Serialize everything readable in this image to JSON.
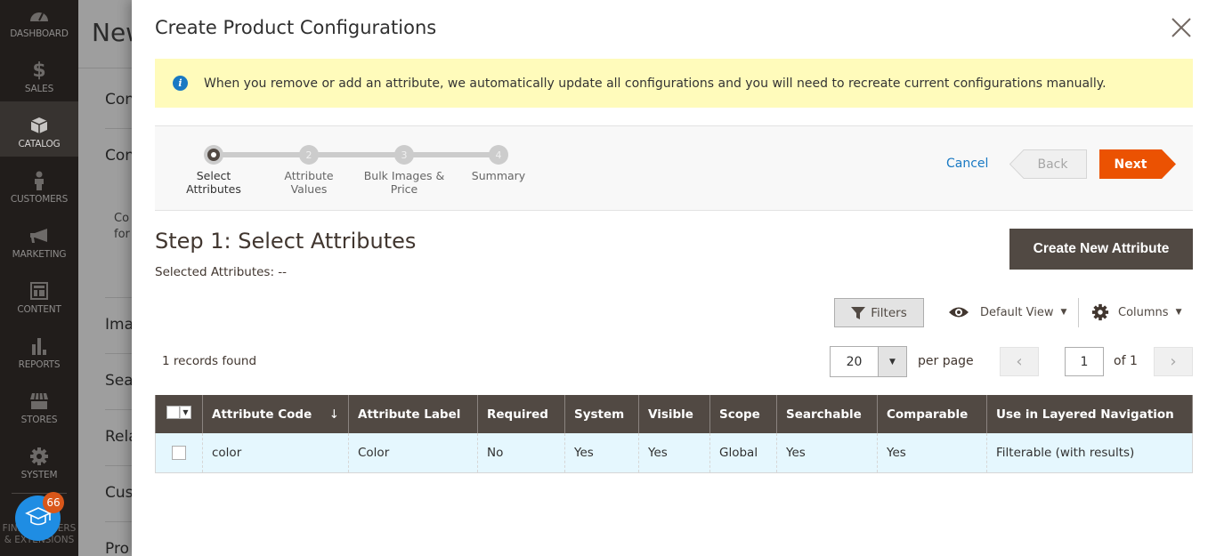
{
  "sidebar": {
    "items": [
      {
        "label": "Dashboard",
        "icon": "dashboard-icon"
      },
      {
        "label": "Sales",
        "icon": "dollar-icon"
      },
      {
        "label": "Catalog",
        "icon": "box-icon",
        "active": true
      },
      {
        "label": "Customers",
        "icon": "person-icon"
      },
      {
        "label": "Marketing",
        "icon": "megaphone-icon"
      },
      {
        "label": "Content",
        "icon": "layout-icon"
      },
      {
        "label": "Reports",
        "icon": "bar-chart-icon"
      },
      {
        "label": "Stores",
        "icon": "storefront-icon"
      },
      {
        "label": "System",
        "icon": "gear-icon"
      }
    ],
    "extensions_label_line1": "Find Partners",
    "extensions_label_line2": "& Extensions",
    "learn_badge_count": "66"
  },
  "background_page": {
    "title": "New",
    "sections": [
      "Con",
      "Con",
      "Ima",
      "Sea",
      "Rela",
      "Cus",
      "Pro"
    ],
    "text_line1": "Co",
    "text_line2": "for"
  },
  "modal": {
    "title": "Create Product Configurations",
    "close_label": "Close",
    "notice": "When you remove or add an attribute, we automatically update all configurations and you will need to recreate current configurations manually.",
    "wizard": {
      "steps": [
        {
          "number": "1",
          "label_line1": "Select",
          "label_line2": "Attributes",
          "active": true
        },
        {
          "number": "2",
          "label_line1": "Attribute",
          "label_line2": "Values"
        },
        {
          "number": "3",
          "label_line1": "Bulk Images &",
          "label_line2": "Price"
        },
        {
          "number": "4",
          "label_line1": "Summary",
          "label_line2": ""
        }
      ],
      "cancel_label": "Cancel",
      "back_label": "Back",
      "next_label": "Next",
      "next_color": "#eb5202"
    },
    "step_title": "Step 1: Select Attributes",
    "selected_attributes": "Selected Attributes: --",
    "create_attribute_label": "Create New Attribute",
    "toolbar": {
      "filters_label": "Filters",
      "view_label": "Default View",
      "columns_label": "Columns"
    },
    "records_found": "1 records found",
    "pagination": {
      "per_page_value": "20",
      "per_page_label": "per page",
      "current_page": "1",
      "of_label": "of 1"
    },
    "grid": {
      "columns": [
        "Attribute Code",
        "Attribute Label",
        "Required",
        "System",
        "Visible",
        "Scope",
        "Searchable",
        "Comparable",
        "Use in Layered Navigation"
      ],
      "rows": [
        [
          "color",
          "Color",
          "No",
          "Yes",
          "Yes",
          "Global",
          "Yes",
          "Yes",
          "Filterable (with results)"
        ]
      ]
    }
  }
}
